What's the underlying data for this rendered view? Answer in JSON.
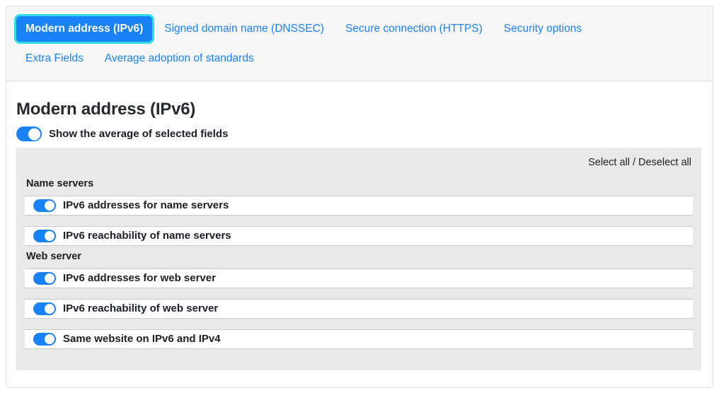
{
  "tabs": [
    {
      "label": "Modern address (IPv6)",
      "active": true
    },
    {
      "label": "Signed domain name (DNSSEC)",
      "active": false
    },
    {
      "label": "Secure connection (HTTPS)",
      "active": false
    },
    {
      "label": "Security options",
      "active": false
    },
    {
      "label": "Extra Fields",
      "active": false
    },
    {
      "label": "Average adoption of standards",
      "active": false
    }
  ],
  "main": {
    "title": "Modern address (IPv6)",
    "average_toggle": {
      "label": "Show the average of selected fields",
      "state": "on"
    },
    "select_all_label": "Select all / Deselect all",
    "groups": [
      {
        "title": "Name servers",
        "fields": [
          {
            "label": "IPv6 addresses for name servers",
            "state": "on"
          },
          {
            "label": "IPv6 reachability of name servers",
            "state": "on"
          }
        ]
      },
      {
        "title": "Web server",
        "fields": [
          {
            "label": "IPv6 addresses for web server",
            "state": "on"
          },
          {
            "label": "IPv6 reachability of web server",
            "state": "on"
          },
          {
            "label": "Same website on IPv6 and IPv4",
            "state": "on"
          }
        ]
      }
    ]
  },
  "colors": {
    "accent_blue": "#1a82f7",
    "focus_ring_cyan": "#2fdde4",
    "panel_grey": "#e9e9e9",
    "header_grey": "#f7f7f7",
    "text_dark": "#1b1e23"
  }
}
